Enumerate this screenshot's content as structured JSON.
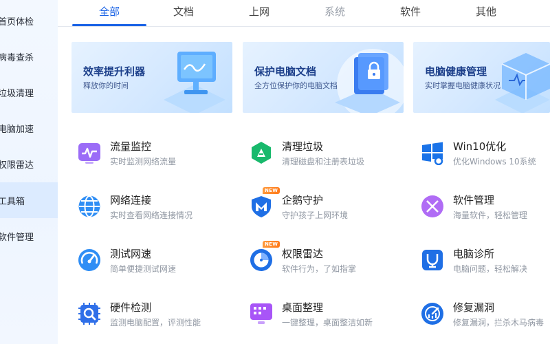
{
  "sidebar": {
    "items": [
      {
        "label": "首页体检"
      },
      {
        "label": "病毒查杀"
      },
      {
        "label": "垃圾清理"
      },
      {
        "label": "电脑加速"
      },
      {
        "label": "权限雷达"
      },
      {
        "label": "工具箱"
      },
      {
        "label": "软件管理"
      }
    ],
    "active_index": 5
  },
  "tabs": [
    {
      "label": "全部"
    },
    {
      "label": "文档"
    },
    {
      "label": "上网"
    },
    {
      "label": "系统"
    },
    {
      "label": "软件"
    },
    {
      "label": "其他"
    }
  ],
  "banners": [
    {
      "title": "效率提升利器",
      "subtitle": "释放你的时间",
      "icon": "monitor-illustration"
    },
    {
      "title": "保护电脑文档",
      "subtitle": "全方位保护你的电脑文档",
      "icon": "locked-folder-illustration"
    },
    {
      "title": "电脑健康管理",
      "subtitle": "实时掌握电脑健康状况",
      "icon": "health-cube-illustration"
    }
  ],
  "tools": [
    {
      "name": "流量监控",
      "desc": "实时监测网络流量",
      "icon": "traffic-monitor-icon",
      "color": "#8b5cf6"
    },
    {
      "name": "清理垃圾",
      "desc": "清理磁盘和注册表垃圾",
      "icon": "clean-junk-icon",
      "color": "#16b96b"
    },
    {
      "name": "Win10优化",
      "desc": "优化Windows 10系统",
      "icon": "windows-icon",
      "color": "#1a73e8"
    },
    {
      "name": "网络连接",
      "desc": "实时查看网络连接情况",
      "icon": "globe-icon",
      "color": "#2f8ef5"
    },
    {
      "name": "企鹅守护",
      "desc": "守护孩子上网环境",
      "icon": "penguin-guard-icon",
      "color": "#1f6fe5",
      "badge": "NEW"
    },
    {
      "name": "软件管理",
      "desc": "海量软件，轻松管理",
      "icon": "software-manage-icon",
      "color": "#a855f7"
    },
    {
      "name": "测试网速",
      "desc": "简单便捷测试网速",
      "icon": "speed-test-icon",
      "color": "#2f8ef5"
    },
    {
      "name": "权限雷达",
      "desc": "软件行为，了如指掌",
      "icon": "radar-icon",
      "color": "#1f6fe5",
      "badge": "NEW"
    },
    {
      "name": "电脑诊所",
      "desc": "电脑问题，轻松解决",
      "icon": "stethoscope-icon",
      "color": "#1f6fe5"
    },
    {
      "name": "硬件检测",
      "desc": "监测电脑配置，评测性能",
      "icon": "chip-search-icon",
      "color": "#2f6fe8"
    },
    {
      "name": "桌面整理",
      "desc": "一键整理，桌面整洁如新",
      "icon": "desktop-organize-icon",
      "color": "#a855f7"
    },
    {
      "name": "修复漏洞",
      "desc": "修复漏洞，拦杀木马病毒",
      "icon": "fix-vulnerability-icon",
      "color": "#1f6fe5"
    }
  ]
}
